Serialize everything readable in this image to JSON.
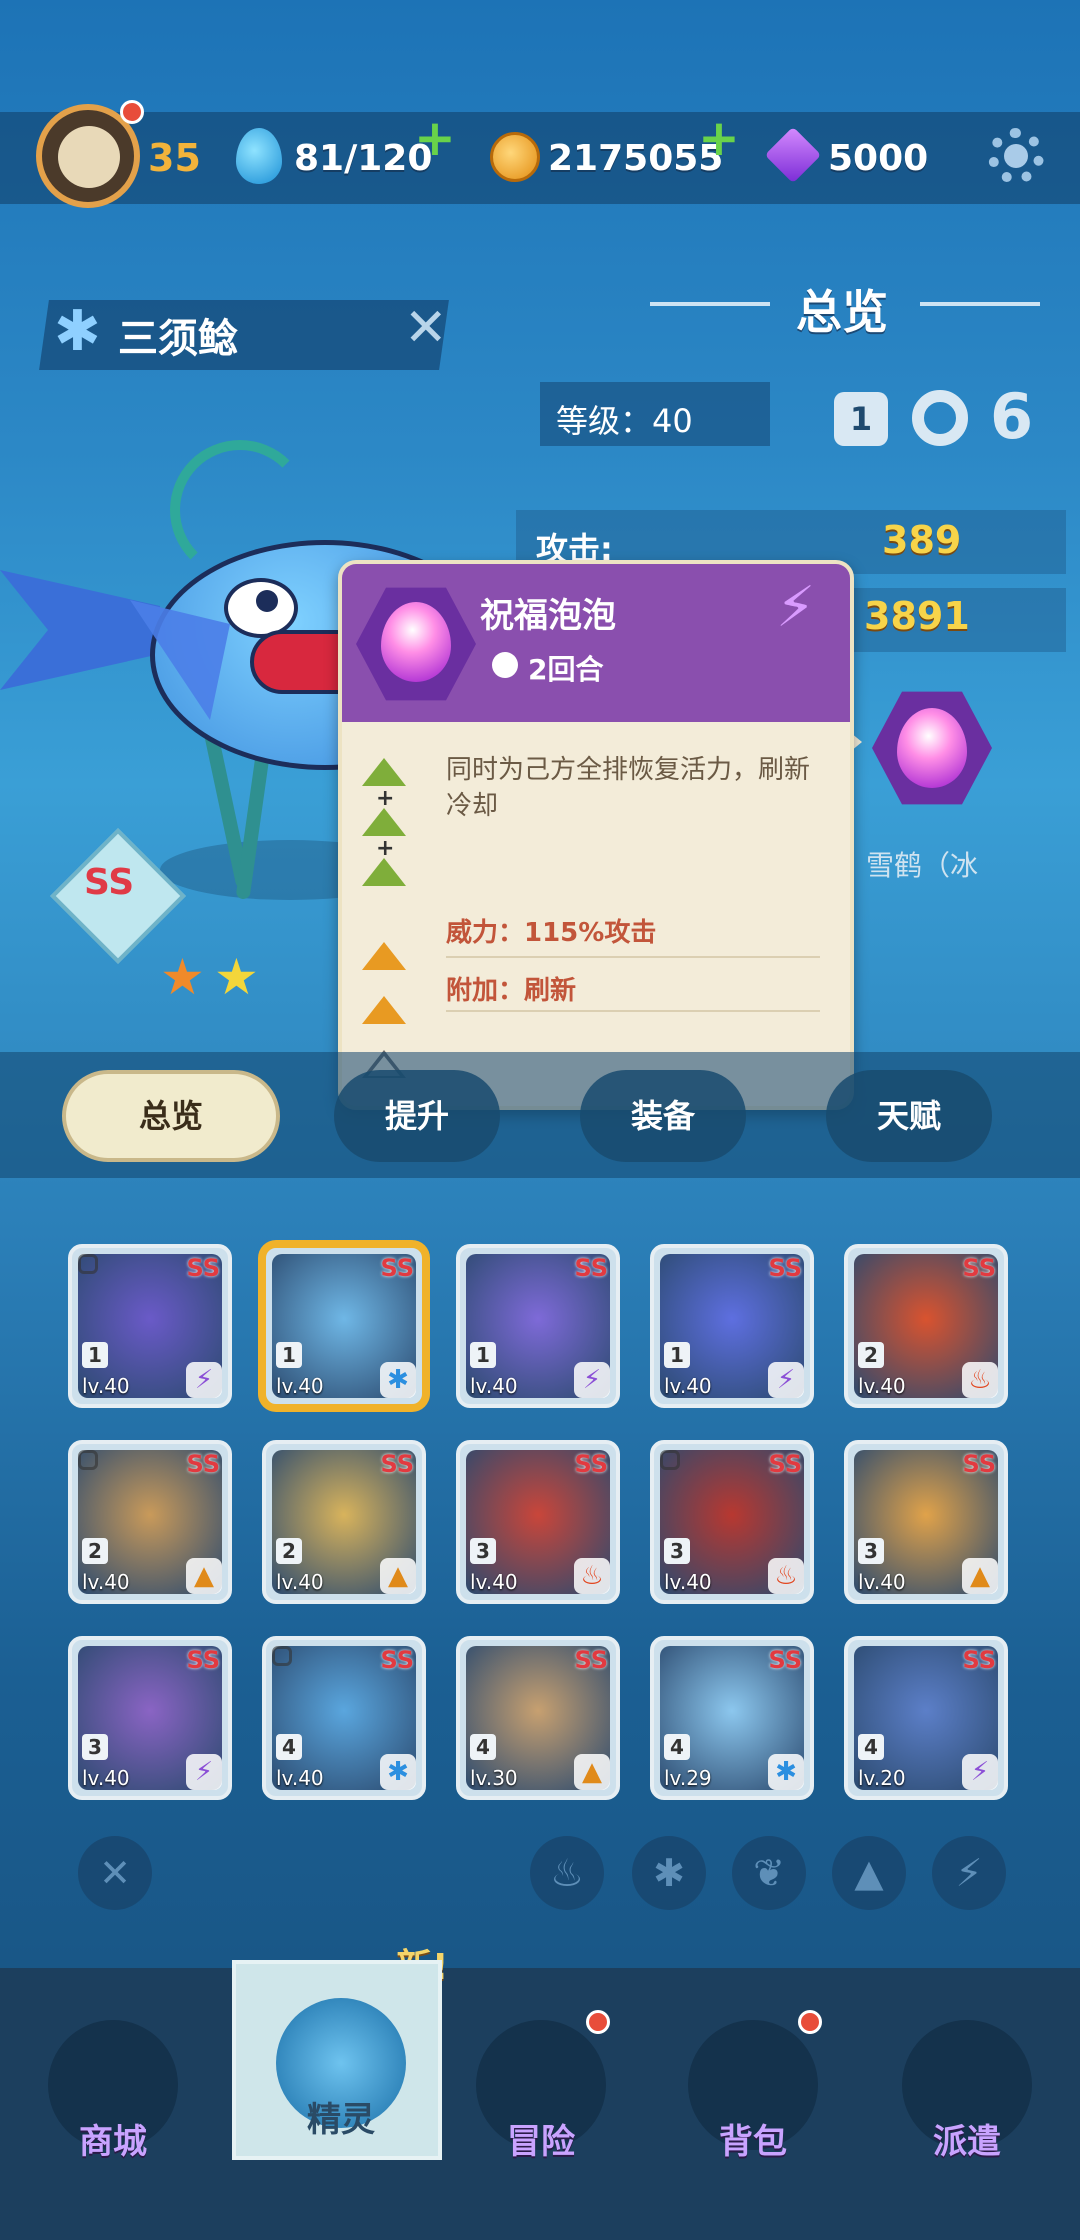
{
  "topbar": {
    "level": "35",
    "energy": "81/120",
    "coins": "2175055",
    "gems": "5000"
  },
  "creature": {
    "name": "三须鲶",
    "rank": "SS",
    "stars": 2
  },
  "overview": {
    "title": "总览",
    "level_label": "等级：40",
    "icon_1_value": "1",
    "attack_label": "攻击:",
    "attack_value": "389",
    "hp_value": "3891",
    "side_skill_name": "雪鹤（冰"
  },
  "tooltip": {
    "title": "祝福泡泡",
    "turns": "2回合",
    "description": "同时为己方全排恢复活力，刷新冷却",
    "power": "威力：115%攻击",
    "extra": "附加：刷新"
  },
  "tabs": [
    {
      "label": "总览",
      "active": true
    },
    {
      "label": "提升",
      "active": false
    },
    {
      "label": "装备",
      "active": false
    },
    {
      "label": "天赋",
      "active": false
    }
  ],
  "cards": [
    {
      "rank": "SS",
      "num": "1",
      "lv": "lv.40",
      "el": "⚡",
      "color": "#6a5ac8",
      "locked": true,
      "selected": false
    },
    {
      "rank": "SS",
      "num": "1",
      "lv": "lv.40",
      "el": "✱",
      "color": "#6fb7e6",
      "locked": false,
      "selected": true
    },
    {
      "rank": "SS",
      "num": "1",
      "lv": "lv.40",
      "el": "⚡",
      "color": "#7e6ad8",
      "locked": false,
      "selected": false
    },
    {
      "rank": "SS",
      "num": "1",
      "lv": "lv.40",
      "el": "⚡",
      "color": "#5e6fe0",
      "locked": false,
      "selected": false
    },
    {
      "rank": "SS",
      "num": "2",
      "lv": "lv.40",
      "el": "♨",
      "color": "#d9532f",
      "locked": false,
      "selected": false
    },
    {
      "rank": "SS",
      "num": "2",
      "lv": "lv.40",
      "el": "▲",
      "color": "#c99a5a",
      "locked": true,
      "selected": false
    },
    {
      "rank": "SS",
      "num": "2",
      "lv": "lv.40",
      "el": "▲",
      "color": "#d8b35c",
      "locked": false,
      "selected": false
    },
    {
      "rank": "SS",
      "num": "3",
      "lv": "lv.40",
      "el": "♨",
      "color": "#c9463a",
      "locked": false,
      "selected": false
    },
    {
      "rank": "SS",
      "num": "3",
      "lv": "lv.40",
      "el": "♨",
      "color": "#b83830",
      "locked": true,
      "selected": false
    },
    {
      "rank": "SS",
      "num": "3",
      "lv": "lv.40",
      "el": "▲",
      "color": "#e0a24a",
      "locked": false,
      "selected": false
    },
    {
      "rank": "SS",
      "num": "3",
      "lv": "lv.40",
      "el": "⚡",
      "color": "#8a64c4",
      "locked": false,
      "selected": false
    },
    {
      "rank": "SS",
      "num": "4",
      "lv": "lv.40",
      "el": "✱",
      "color": "#5aa6de",
      "locked": true,
      "selected": false
    },
    {
      "rank": "SS",
      "num": "4",
      "lv": "lv.30",
      "el": "▲",
      "color": "#c7a070",
      "locked": false,
      "selected": false
    },
    {
      "rank": "SS",
      "num": "4",
      "lv": "lv.29",
      "el": "✱",
      "color": "#8cc7ee",
      "locked": false,
      "selected": false
    },
    {
      "rank": "SS",
      "num": "4",
      "lv": "lv.20",
      "el": "⚡",
      "color": "#5c7fc8",
      "locked": false,
      "selected": false
    }
  ],
  "filters": [
    "✕",
    "♨",
    "✱",
    "❦",
    "▲",
    "⚡"
  ],
  "nav": [
    {
      "label": "商城",
      "icon": "shop-icon",
      "active": false,
      "dot": false
    },
    {
      "label": "精灵",
      "icon": "spirit-icon",
      "active": true,
      "dot": false
    },
    {
      "label": "冒险",
      "icon": "adventure-icon",
      "active": false,
      "dot": true
    },
    {
      "label": "背包",
      "icon": "backpack-icon",
      "active": false,
      "dot": true
    },
    {
      "label": "派遣",
      "icon": "dispatch-icon",
      "active": false,
      "dot": false
    }
  ],
  "new_tag": "新!"
}
